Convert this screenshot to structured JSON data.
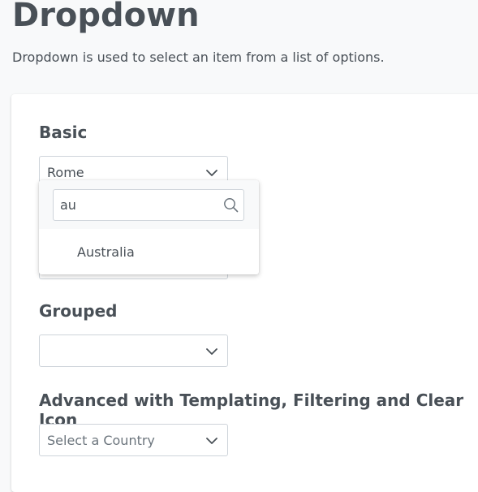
{
  "header": {
    "title": "Dropdown",
    "description": "Dropdown is used to select an item from a list of options."
  },
  "sections": {
    "basic": {
      "heading": "Basic",
      "selected": "Rome",
      "chevron_icon": "chevron-down-icon"
    },
    "grouped": {
      "heading": "Grouped",
      "selected": ""
    },
    "advanced": {
      "heading": "Advanced with Templating, Filtering and Clear Icon",
      "placeholder": "Select a Country"
    }
  },
  "overlay": {
    "filter_value": "au",
    "search_icon": "search-icon",
    "options": [
      {
        "label": "Australia"
      }
    ]
  },
  "colors": {
    "page_bg": "#f8f9fa",
    "text": "#495057",
    "border": "#ced4da",
    "card_bg": "#ffffff"
  }
}
